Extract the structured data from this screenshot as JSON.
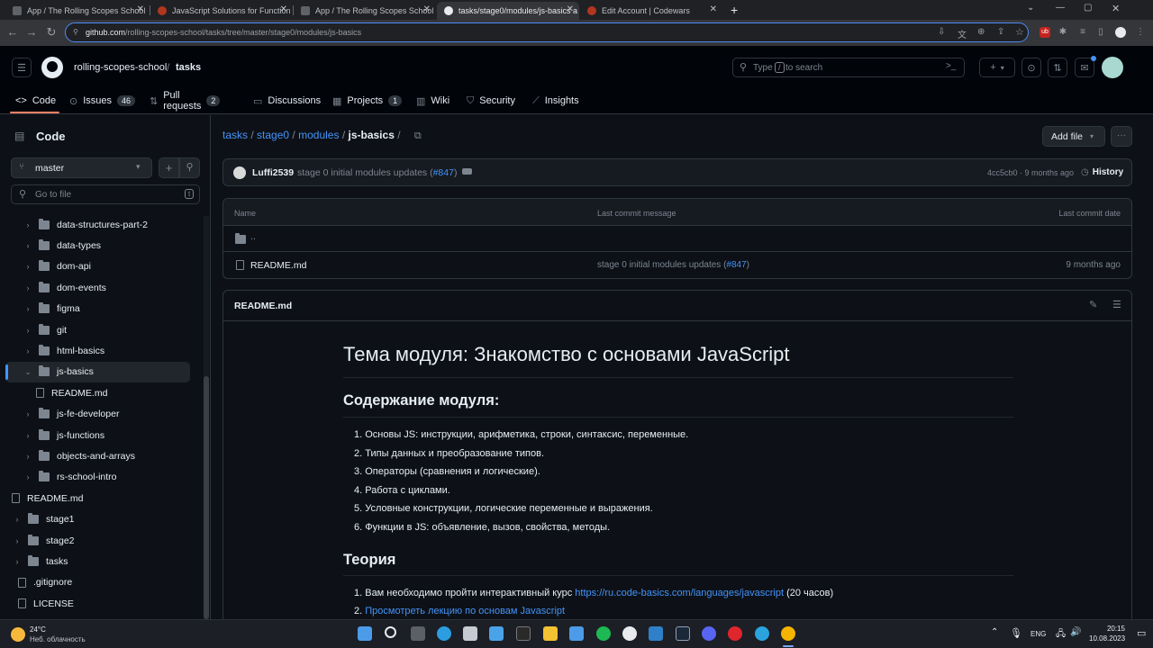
{
  "browser": {
    "tabs": [
      {
        "label": "App / The Rolling Scopes School",
        "color": "#5f6368"
      },
      {
        "label": "JavaScript Solutions for Function",
        "color": "#b1361e"
      },
      {
        "label": "App / The Rolling Scopes School",
        "color": "#5f6368"
      },
      {
        "label": "tasks/stage0/modules/js-basics a",
        "color": "#e8eaed"
      },
      {
        "label": "Edit Account | Codewars",
        "color": "#b1361e"
      }
    ],
    "new_tab": "+",
    "url_host": "github.com",
    "url_path": "/rolling-scopes-school/tasks/tree/master/stage0/modules/js-basics"
  },
  "header": {
    "owner": "rolling-scopes-school",
    "separator": "/",
    "repo": "tasks",
    "search_placeholder_pre": "Type",
    "search_key": "/",
    "search_placeholder_post": "to search",
    "plus": "+"
  },
  "repo_tabs": [
    {
      "label": "Code",
      "icon": "code-icon"
    },
    {
      "label": "Issues",
      "icon": "issue-icon",
      "count": "46"
    },
    {
      "label": "Pull requests",
      "icon": "pull-request-icon",
      "count": "2"
    },
    {
      "label": "Discussions",
      "icon": "discussion-icon"
    },
    {
      "label": "Projects",
      "icon": "project-icon",
      "count": "1"
    },
    {
      "label": "Wiki",
      "icon": "book-icon"
    },
    {
      "label": "Security",
      "icon": "shield-icon"
    },
    {
      "label": "Insights",
      "icon": "graph-icon"
    }
  ],
  "sidebar": {
    "title": "Code",
    "branch": "master",
    "goto_placeholder": "Go to file",
    "goto_key": "t",
    "tree": [
      {
        "label": "data-structures-part-2",
        "type": "folder",
        "level": 1
      },
      {
        "label": "data-types",
        "type": "folder",
        "level": 1
      },
      {
        "label": "dom-api",
        "type": "folder",
        "level": 1
      },
      {
        "label": "dom-events",
        "type": "folder",
        "level": 1
      },
      {
        "label": "figma",
        "type": "folder",
        "level": 1
      },
      {
        "label": "git",
        "type": "folder",
        "level": 1
      },
      {
        "label": "html-basics",
        "type": "folder",
        "level": 1
      },
      {
        "label": "js-basics",
        "type": "folder-open",
        "level": 1
      },
      {
        "label": "README.md",
        "type": "file",
        "level": 2
      },
      {
        "label": "js-fe-developer",
        "type": "folder",
        "level": 1
      },
      {
        "label": "js-functions",
        "type": "folder",
        "level": 1
      },
      {
        "label": "objects-and-arrays",
        "type": "folder",
        "level": 1
      },
      {
        "label": "rs-school-intro",
        "type": "folder",
        "level": 1
      },
      {
        "label": "README.md",
        "type": "file",
        "level": 0
      },
      {
        "label": "stage1",
        "type": "folder",
        "level": 0
      },
      {
        "label": "stage2",
        "type": "folder",
        "level": 0
      },
      {
        "label": "tasks",
        "type": "folder",
        "level": 0
      },
      {
        "label": ".gitignore",
        "type": "file",
        "level": -1
      },
      {
        "label": "LICENSE",
        "type": "file",
        "level": -1
      }
    ]
  },
  "breadcrumb": {
    "parts": [
      "tasks",
      "stage0",
      "modules"
    ],
    "current": "js-basics",
    "sep": "/"
  },
  "actions": {
    "add_file": "Add file",
    "more": "···"
  },
  "commit": {
    "author": "Luffi2539",
    "message": "stage 0 initial modules updates (",
    "pr": "#847",
    "message_end": ")",
    "hash_time": "4cc5cb0 · 9 months ago",
    "history": "History"
  },
  "table": {
    "headers": [
      "Name",
      "Last commit message",
      "Last commit date"
    ],
    "parent": "..",
    "rows": [
      {
        "name": "README.md",
        "message": "stage 0 initial modules updates (",
        "pr": "#847",
        "message_end": ")",
        "date": "9 months ago"
      }
    ]
  },
  "readme": {
    "filename": "README.md",
    "h1": "Тема модуля: Знакомство с основами JavaScript",
    "h2_contents": "Содержание модуля:",
    "contents": [
      "1. Основы JS: инструкции, арифметика, строки, синтаксис, переменные.",
      "2. Типы данных и преобразование типов.",
      "3. Операторы (сравнения и логические).",
      "4. Работа с циклами.",
      "5. Условные конструкции, логические переменные и выражения.",
      "6. Функции в JS: объявление, вызов, свойства, методы."
    ],
    "h2_theory": "Теория",
    "theory1_pre": "1. Вам необходимо пройти интерактивный курс ",
    "theory1_link": "https://ru.code-basics.com/languages/javascript",
    "theory1_post": " (20 часов)",
    "theory2_num": "2. ",
    "theory2_link": "Просмотреть лекцию по основам Javascript"
  },
  "taskbar": {
    "temp": "24°C",
    "weather": "Неб. облачность",
    "lang": "ENG",
    "time": "20:15",
    "date": "10.08.2023"
  }
}
